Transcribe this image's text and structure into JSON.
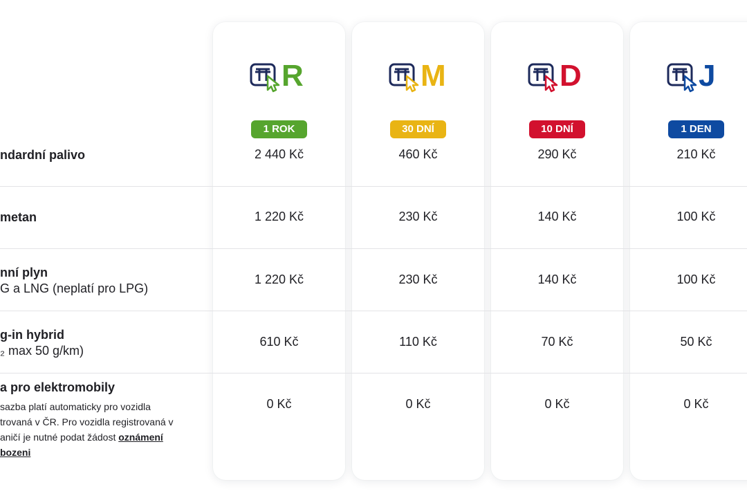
{
  "colors": {
    "R": "#56a52e",
    "M": "#e9b414",
    "D": "#d2112e",
    "J": "#0e4aa1"
  },
  "plans": [
    {
      "letter": "R",
      "badge": "1 ROK"
    },
    {
      "letter": "M",
      "badge": "30 DNÍ"
    },
    {
      "letter": "D",
      "badge": "10 DNÍ"
    },
    {
      "letter": "J",
      "badge": "1 DEN"
    }
  ],
  "rows": [
    {
      "title": "ndardní palivo",
      "sub": "",
      "prices": [
        "2 440 Kč",
        "460 Kč",
        "290 Kč",
        "210 Kč"
      ]
    },
    {
      "title": "metan",
      "sub": "",
      "prices": [
        "1 220 Kč",
        "230 Kč",
        "140 Kč",
        "100 Kč"
      ]
    },
    {
      "title": "nní plyn",
      "sub": "G a LNG (neplatí pro LPG)",
      "prices": [
        "1 220 Kč",
        "230 Kč",
        "140 Kč",
        "100 Kč"
      ]
    },
    {
      "title": "g-in hybrid",
      "sub": "₂ max 50 g/km)",
      "prices": [
        "610 Kč",
        "110 Kč",
        "70 Kč",
        "50 Kč"
      ]
    },
    {
      "title": "a pro elektromobily",
      "sub": "",
      "prices": [
        "0 Kč",
        "0 Kč",
        "0 Kč",
        "0 Kč"
      ]
    }
  ],
  "note": {
    "line1": "sazba platí automaticky pro vozidla",
    "line2": "trovaná v ČR. Pro vozidla registrovaná v",
    "line3": "aničí je nutné podat žádost ",
    "link1": "oznámení",
    "link2": "bozeni"
  },
  "icons": {
    "vignette": "highway-cursor-icon"
  }
}
